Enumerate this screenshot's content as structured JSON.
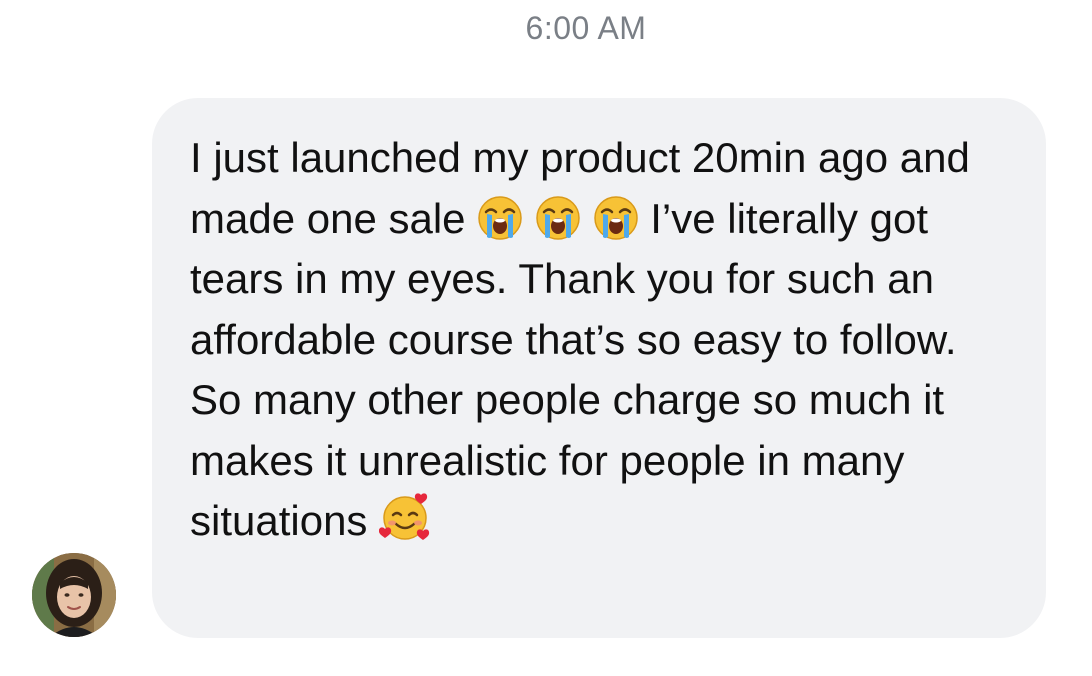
{
  "thread": {
    "timestamp": "6:00 AM"
  },
  "message": {
    "text_part1": "I just launched my product 20min ago and made one sale ",
    "emoji_1": "loudly-crying-face",
    "emoji_2": "loudly-crying-face",
    "emoji_3": "loudly-crying-face",
    "text_part2": " I’ve literally got tears in my eyes. Thank you for such an affordable course that’s so easy to follow. So many other people charge so much it makes it unrealistic for people in many situations ",
    "emoji_4": "smiling-face-with-hearts",
    "bubble_color": "#f1f2f4",
    "text_color": "#111111"
  },
  "sender": {
    "avatar_icon": "user-avatar-photo"
  }
}
